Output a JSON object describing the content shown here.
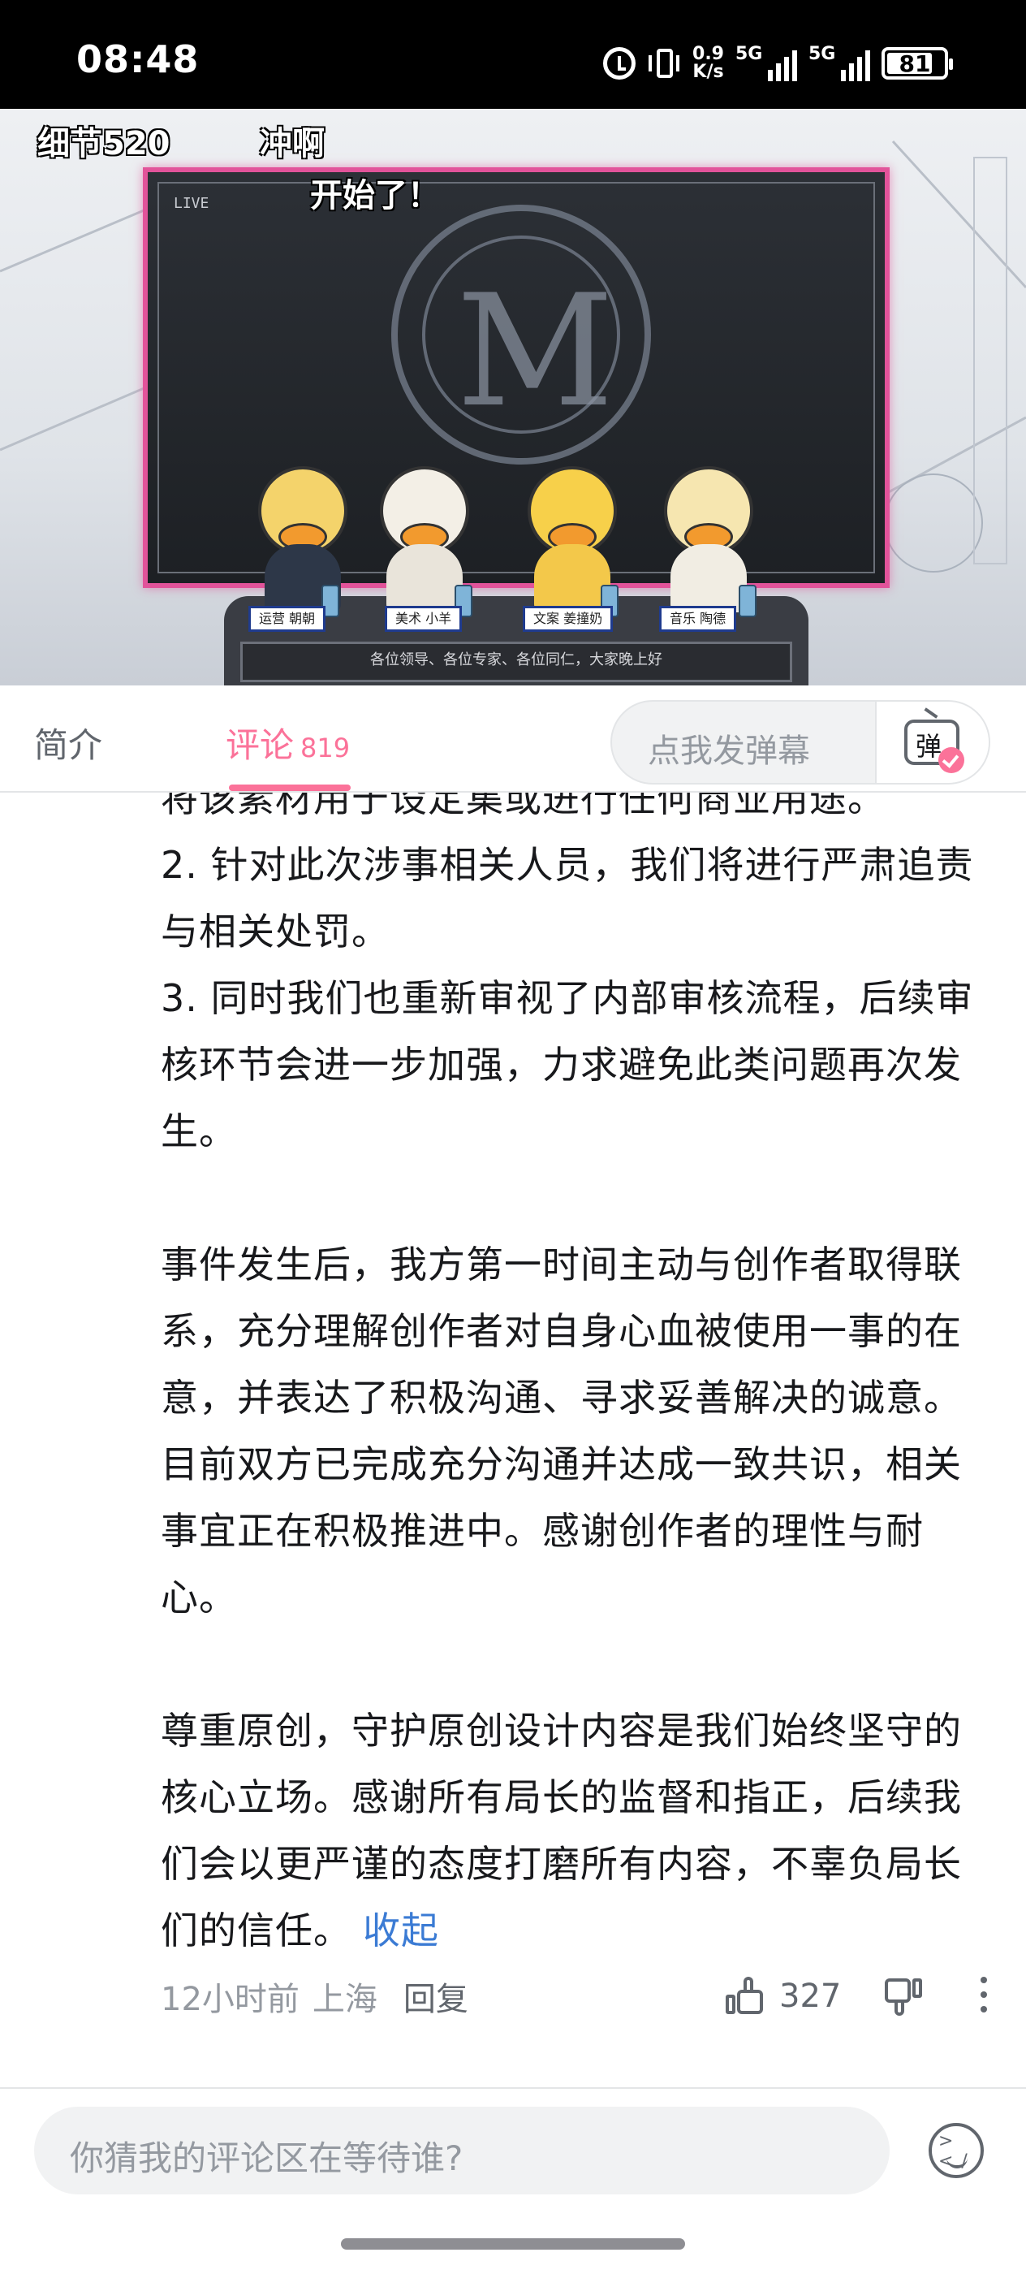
{
  "status_bar": {
    "time": "08:48",
    "net_speed_value": "0.9",
    "net_speed_unit": "K/s",
    "sim1": "5G",
    "sim2": "5G",
    "battery": "81",
    "battery_level": 0.81,
    "icons": [
      "alarm-icon",
      "vibrate-icon",
      "signal-icon",
      "battery-icon"
    ]
  },
  "video": {
    "overlay_texts": [
      "细节520",
      "冲啊",
      "开始了！"
    ],
    "name_cards": [
      "运营 朝朝",
      "美术 小羊",
      "文案 姜撞奶",
      "音乐 陶德"
    ],
    "desk_caption": "各位领导、各位专家、各位同仁，大家晚上好",
    "screen_label": "LIVE"
  },
  "tabs": {
    "intro": "简介",
    "comments": "评论",
    "comments_count": "819",
    "danmaku_placeholder": "点我发弹幕",
    "danmaku_icon_char": "弹"
  },
  "comment": {
    "paragraphs": [
      "将该素材用于设定集或进行任何商业用途。",
      "2. 针对此次涉事相关人员，我们将进行严肃追责与相关处罚。",
      "3. 同时我们也重新审视了内部审核流程，后续审核环节会进一步加强，力求避免此类问题再次发生。",
      "",
      "事件发生后，我方第一时间主动与创作者取得联系，充分理解创作者对自身心血被使用一事的在意，并表达了积极沟通、寻求妥善解决的诚意。目前双方已完成充分沟通并达成一致共识，相关事宜正在积极推进中。感谢创作者的理性与耐心。",
      "",
      "尊重原创，守护原创设计内容是我们始终坚守的核心立场。感谢所有局长的监督和指正，后续我们会以更严谨的态度打磨所有内容，不辜负局长们的信任。"
    ],
    "collapse_label": "收起",
    "time": "12小时前",
    "location": "上海",
    "reply_label": "回复",
    "likes": "327"
  },
  "bottom_bar": {
    "input_placeholder": "你猜我的评论区在等待谁?"
  },
  "colors": {
    "accent_pink": "#fb7299",
    "link_blue": "#3b7bd4",
    "frame_pink": "#e2539a"
  }
}
